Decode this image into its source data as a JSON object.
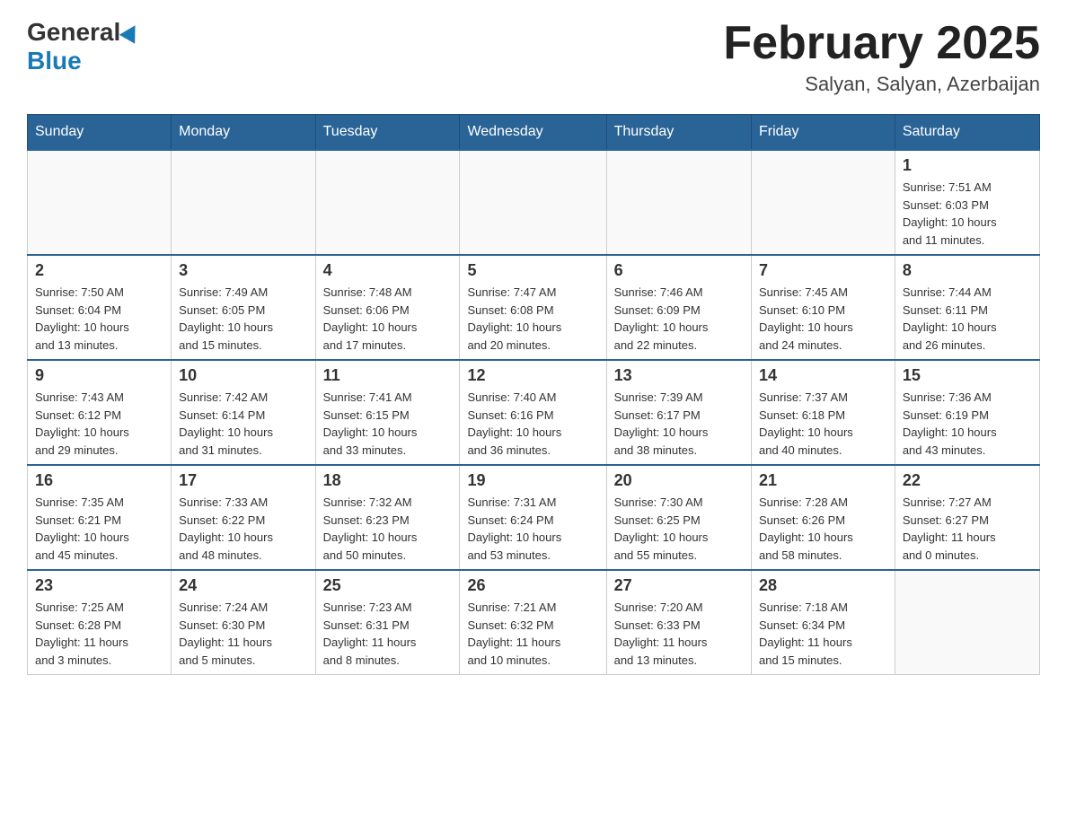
{
  "header": {
    "logo": {
      "general": "General",
      "blue": "Blue"
    },
    "title": "February 2025",
    "location": "Salyan, Salyan, Azerbaijan"
  },
  "weekdays": [
    "Sunday",
    "Monday",
    "Tuesday",
    "Wednesday",
    "Thursday",
    "Friday",
    "Saturday"
  ],
  "weeks": [
    [
      {
        "day": "",
        "info": ""
      },
      {
        "day": "",
        "info": ""
      },
      {
        "day": "",
        "info": ""
      },
      {
        "day": "",
        "info": ""
      },
      {
        "day": "",
        "info": ""
      },
      {
        "day": "",
        "info": ""
      },
      {
        "day": "1",
        "info": "Sunrise: 7:51 AM\nSunset: 6:03 PM\nDaylight: 10 hours\nand 11 minutes."
      }
    ],
    [
      {
        "day": "2",
        "info": "Sunrise: 7:50 AM\nSunset: 6:04 PM\nDaylight: 10 hours\nand 13 minutes."
      },
      {
        "day": "3",
        "info": "Sunrise: 7:49 AM\nSunset: 6:05 PM\nDaylight: 10 hours\nand 15 minutes."
      },
      {
        "day": "4",
        "info": "Sunrise: 7:48 AM\nSunset: 6:06 PM\nDaylight: 10 hours\nand 17 minutes."
      },
      {
        "day": "5",
        "info": "Sunrise: 7:47 AM\nSunset: 6:08 PM\nDaylight: 10 hours\nand 20 minutes."
      },
      {
        "day": "6",
        "info": "Sunrise: 7:46 AM\nSunset: 6:09 PM\nDaylight: 10 hours\nand 22 minutes."
      },
      {
        "day": "7",
        "info": "Sunrise: 7:45 AM\nSunset: 6:10 PM\nDaylight: 10 hours\nand 24 minutes."
      },
      {
        "day": "8",
        "info": "Sunrise: 7:44 AM\nSunset: 6:11 PM\nDaylight: 10 hours\nand 26 minutes."
      }
    ],
    [
      {
        "day": "9",
        "info": "Sunrise: 7:43 AM\nSunset: 6:12 PM\nDaylight: 10 hours\nand 29 minutes."
      },
      {
        "day": "10",
        "info": "Sunrise: 7:42 AM\nSunset: 6:14 PM\nDaylight: 10 hours\nand 31 minutes."
      },
      {
        "day": "11",
        "info": "Sunrise: 7:41 AM\nSunset: 6:15 PM\nDaylight: 10 hours\nand 33 minutes."
      },
      {
        "day": "12",
        "info": "Sunrise: 7:40 AM\nSunset: 6:16 PM\nDaylight: 10 hours\nand 36 minutes."
      },
      {
        "day": "13",
        "info": "Sunrise: 7:39 AM\nSunset: 6:17 PM\nDaylight: 10 hours\nand 38 minutes."
      },
      {
        "day": "14",
        "info": "Sunrise: 7:37 AM\nSunset: 6:18 PM\nDaylight: 10 hours\nand 40 minutes."
      },
      {
        "day": "15",
        "info": "Sunrise: 7:36 AM\nSunset: 6:19 PM\nDaylight: 10 hours\nand 43 minutes."
      }
    ],
    [
      {
        "day": "16",
        "info": "Sunrise: 7:35 AM\nSunset: 6:21 PM\nDaylight: 10 hours\nand 45 minutes."
      },
      {
        "day": "17",
        "info": "Sunrise: 7:33 AM\nSunset: 6:22 PM\nDaylight: 10 hours\nand 48 minutes."
      },
      {
        "day": "18",
        "info": "Sunrise: 7:32 AM\nSunset: 6:23 PM\nDaylight: 10 hours\nand 50 minutes."
      },
      {
        "day": "19",
        "info": "Sunrise: 7:31 AM\nSunset: 6:24 PM\nDaylight: 10 hours\nand 53 minutes."
      },
      {
        "day": "20",
        "info": "Sunrise: 7:30 AM\nSunset: 6:25 PM\nDaylight: 10 hours\nand 55 minutes."
      },
      {
        "day": "21",
        "info": "Sunrise: 7:28 AM\nSunset: 6:26 PM\nDaylight: 10 hours\nand 58 minutes."
      },
      {
        "day": "22",
        "info": "Sunrise: 7:27 AM\nSunset: 6:27 PM\nDaylight: 11 hours\nand 0 minutes."
      }
    ],
    [
      {
        "day": "23",
        "info": "Sunrise: 7:25 AM\nSunset: 6:28 PM\nDaylight: 11 hours\nand 3 minutes."
      },
      {
        "day": "24",
        "info": "Sunrise: 7:24 AM\nSunset: 6:30 PM\nDaylight: 11 hours\nand 5 minutes."
      },
      {
        "day": "25",
        "info": "Sunrise: 7:23 AM\nSunset: 6:31 PM\nDaylight: 11 hours\nand 8 minutes."
      },
      {
        "day": "26",
        "info": "Sunrise: 7:21 AM\nSunset: 6:32 PM\nDaylight: 11 hours\nand 10 minutes."
      },
      {
        "day": "27",
        "info": "Sunrise: 7:20 AM\nSunset: 6:33 PM\nDaylight: 11 hours\nand 13 minutes."
      },
      {
        "day": "28",
        "info": "Sunrise: 7:18 AM\nSunset: 6:34 PM\nDaylight: 11 hours\nand 15 minutes."
      },
      {
        "day": "",
        "info": ""
      }
    ]
  ]
}
